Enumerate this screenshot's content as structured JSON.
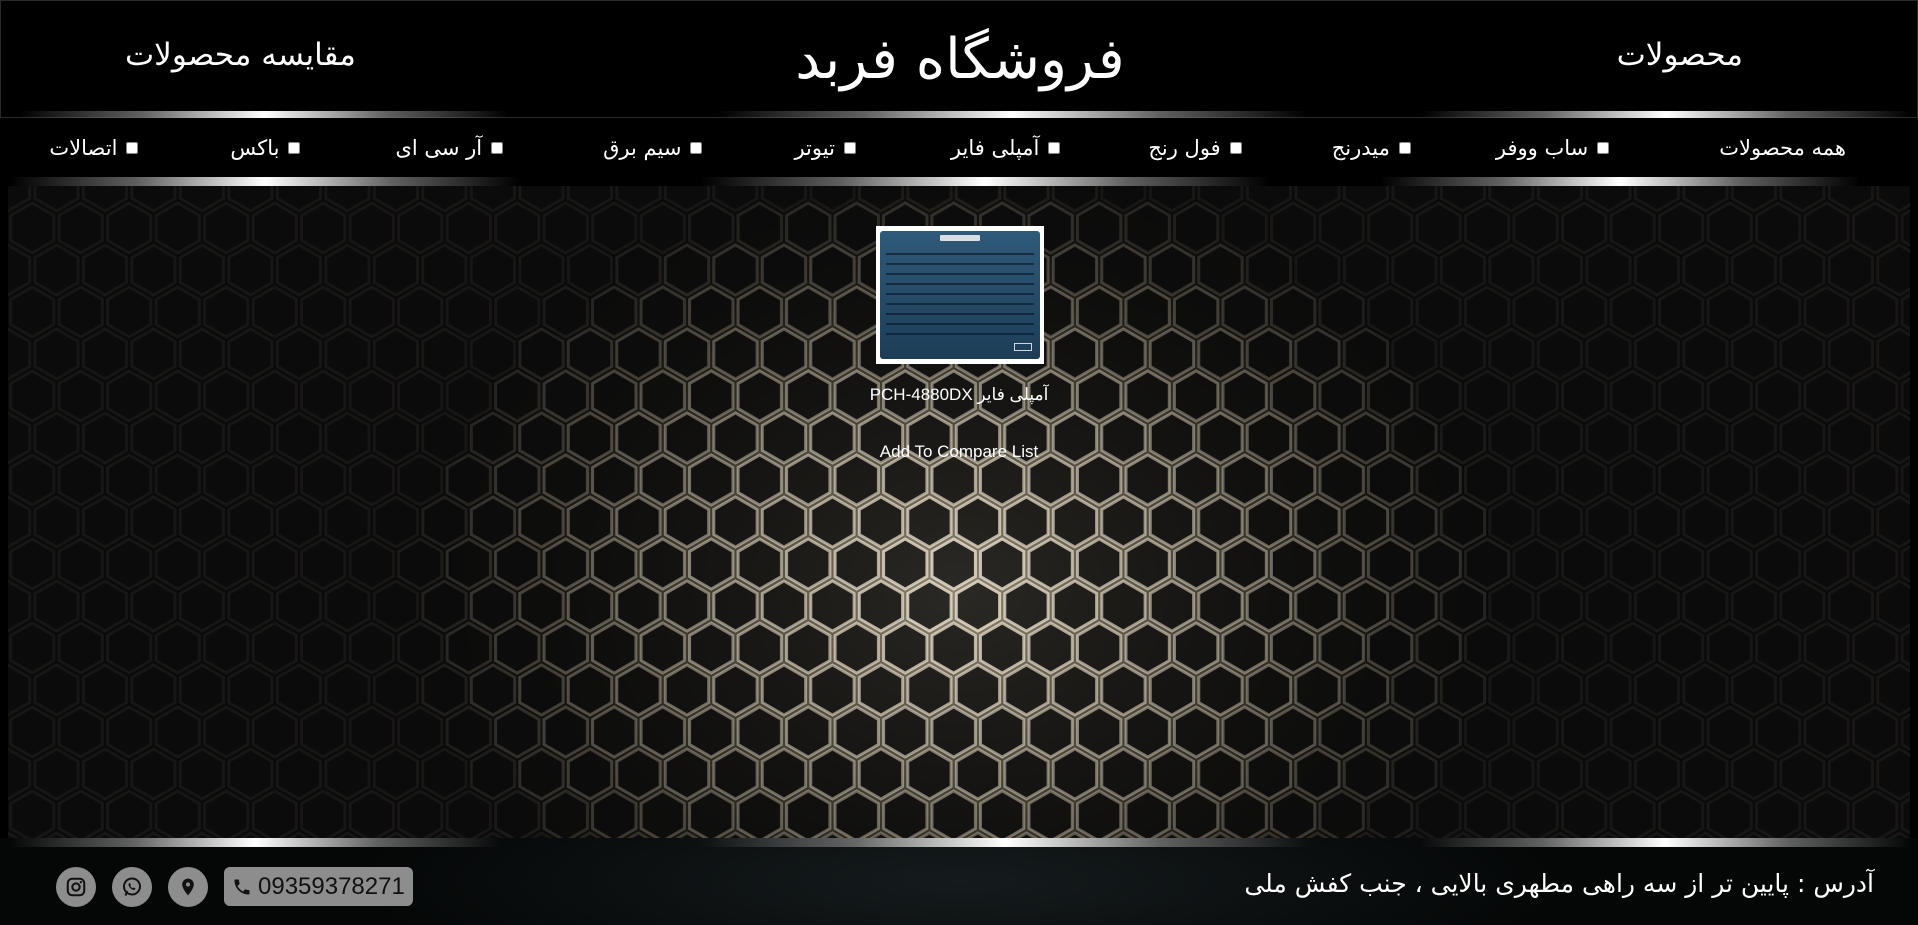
{
  "header": {
    "products_link": "محصولات",
    "store_title": "فروشگاه فربد",
    "compare_link": "مقایسه محصولات"
  },
  "categories": [
    {
      "label": "همه محصولات",
      "checkbox": false
    },
    {
      "label": "ساب ووفر",
      "checkbox": true
    },
    {
      "label": "میدرنج",
      "checkbox": true
    },
    {
      "label": "فول رنج",
      "checkbox": true
    },
    {
      "label": "آمپلی فایر",
      "checkbox": true
    },
    {
      "label": "تیوتر",
      "checkbox": true
    },
    {
      "label": "سیم برق",
      "checkbox": true
    },
    {
      "label": "آر سی ای",
      "checkbox": true
    },
    {
      "label": "باکس",
      "checkbox": true
    },
    {
      "label": "اتصالات",
      "checkbox": true
    }
  ],
  "product": {
    "name": "آمپلی فایر PCH-4880DX",
    "compare_button": "Add To Compare List"
  },
  "footer": {
    "address": "آدرس : پایین تر از سه راهی مطهری بالایی ، جنب کفش ملی",
    "phone": "09359378271",
    "icons": [
      "phone-icon",
      "location-icon",
      "whatsapp-icon",
      "instagram-icon"
    ]
  },
  "colors": {
    "background": "#000000",
    "text": "#ffffff",
    "icon_bg": "#8d8d8d"
  }
}
